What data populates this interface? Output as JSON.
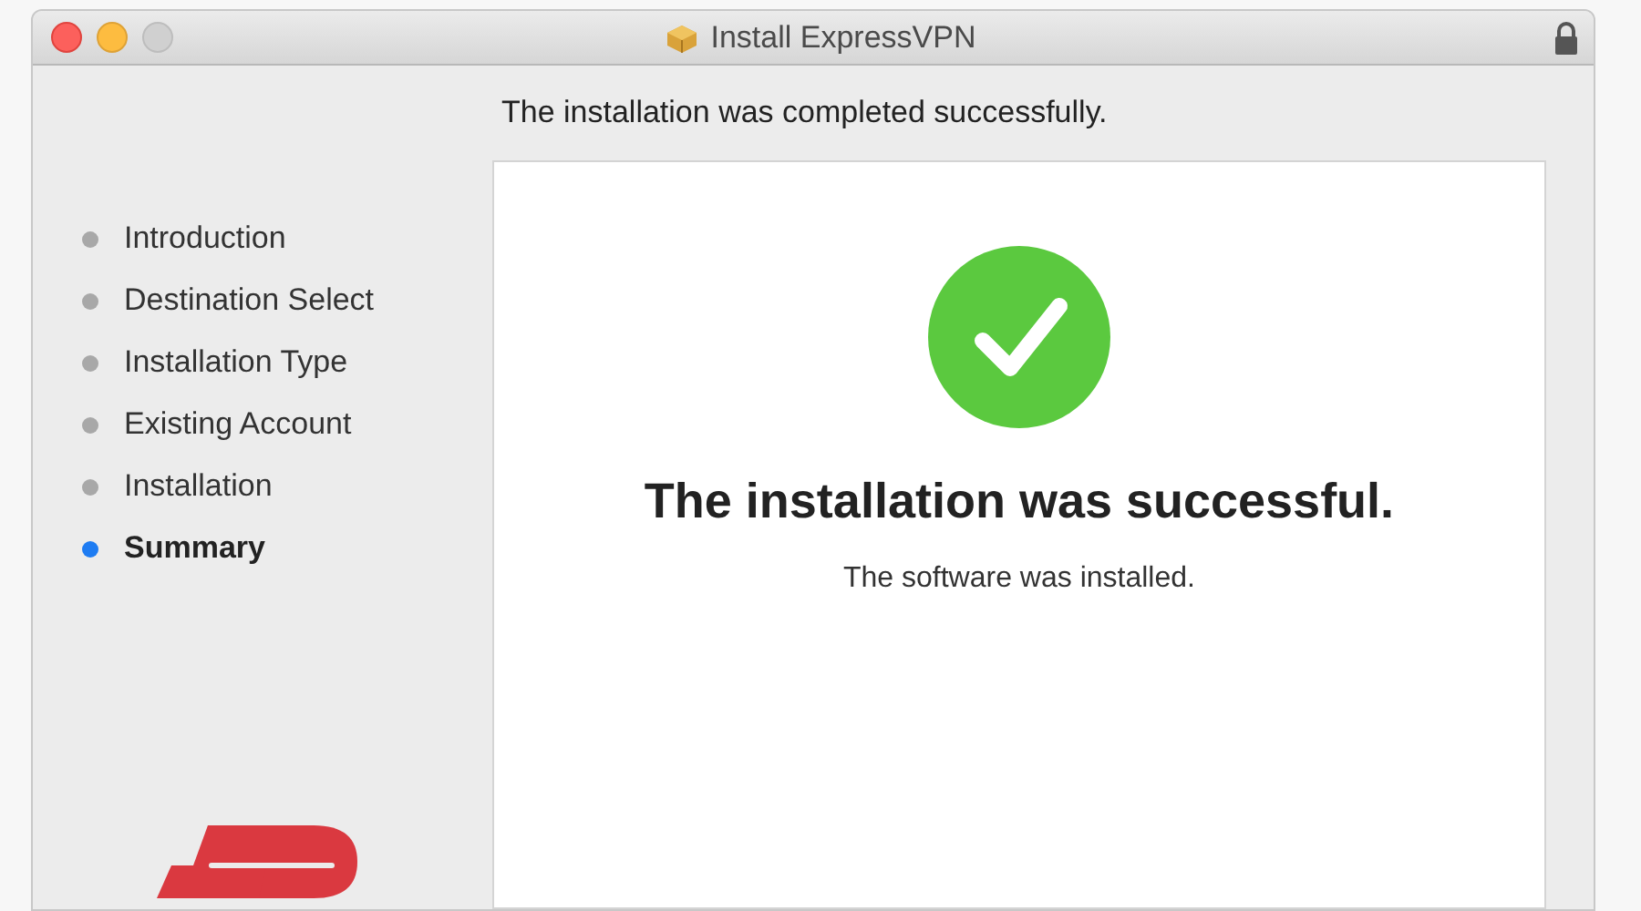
{
  "window": {
    "title": "Install ExpressVPN"
  },
  "header": "The installation was completed successfully.",
  "steps": [
    {
      "label": "Introduction",
      "selected": false
    },
    {
      "label": "Destination Select",
      "selected": false
    },
    {
      "label": "Installation Type",
      "selected": false
    },
    {
      "label": "Existing Account",
      "selected": false
    },
    {
      "label": "Installation",
      "selected": false
    },
    {
      "label": "Summary",
      "selected": true
    }
  ],
  "result": {
    "title": "The installation was successful.",
    "message": "The software was installed."
  }
}
